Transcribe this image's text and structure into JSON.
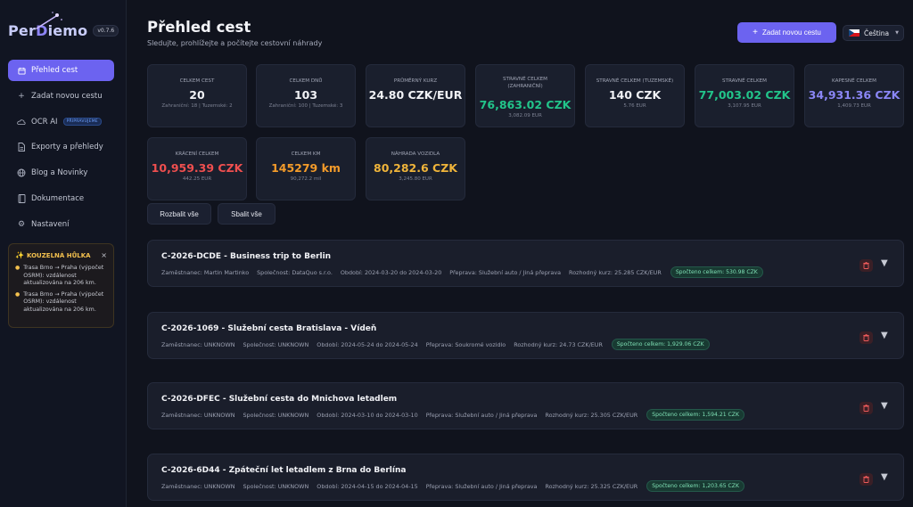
{
  "app": {
    "name_pre": "Per",
    "name_mid": "D",
    "name_post": "iemo",
    "version": "v0.7.6"
  },
  "sidebar": {
    "items": [
      {
        "label": "Přehled cest",
        "icon": "calendar-icon",
        "active": true
      },
      {
        "label": "Zadat novou cestu",
        "icon": "plus-icon"
      },
      {
        "label": "OCR AI",
        "icon": "cloud-icon",
        "badge": "PŘIPRAVUJEME"
      },
      {
        "label": "Exporty a přehledy",
        "icon": "document-icon"
      },
      {
        "label": "Blog a Novinky",
        "icon": "globe-icon"
      },
      {
        "label": "Dokumentace",
        "icon": "book-icon"
      },
      {
        "label": "Nastavení",
        "icon": "gear-icon"
      }
    ],
    "magic": {
      "title": "KOUZELNÁ HŮLKA",
      "close": "×",
      "items": [
        "Trasa Brno → Praha (výpočet OSRM): vzdálenost aktualizována na 206 km.",
        "Trasa Brno → Praha (výpočet OSRM): vzdálenost aktualizována na 206 km."
      ]
    }
  },
  "header": {
    "title": "Přehled cest",
    "subtitle": "Sledujte, prohlížejte a počítejte cestovní náhrady",
    "add_button": "Zadat novou cestu",
    "language": "Čeština"
  },
  "stats": [
    {
      "label": "CELKEM CEST",
      "value": "20",
      "sub": "Zahraniční: 18 | Tuzemské: 2",
      "color": "default"
    },
    {
      "label": "CELKEM DNŮ",
      "value": "103",
      "sub": "Zahraniční: 100 | Tuzemské: 3",
      "color": "default"
    },
    {
      "label": "PRŮMĚRNÝ KURZ",
      "value": "24.80 CZK/EUR",
      "sub": "",
      "color": "default"
    },
    {
      "label": "STRAVNÉ CELKEM",
      "label2": "(ZAHRANIČNÍ)",
      "value": "76,863.02 CZK",
      "sub": "3,082.09 EUR",
      "color": "green"
    },
    {
      "label": "STRAVNÉ CELKEM (TUZEMSKÉ)",
      "value": "140 CZK",
      "sub": "5.76 EUR",
      "color": "default"
    },
    {
      "label": "STRAVNÉ CELKEM",
      "value": "77,003.02 CZK",
      "sub": "3,107.95 EUR",
      "color": "green"
    },
    {
      "label": "KAPESNÉ CELKEM",
      "value": "34,931.36 CZK",
      "sub": "1,409.73 EUR",
      "color": "purple"
    },
    {
      "label": "KRÁCENÍ CELKEM",
      "value": "10,959.39 CZK",
      "sub": "442.25 EUR",
      "color": "red"
    },
    {
      "label": "CELKEM KM",
      "value": "145279 km",
      "sub": "90,272.2 mil",
      "color": "orange"
    },
    {
      "label": "NÁHRADA VOZIDLA",
      "value": "80,282.6 CZK",
      "sub": "3,245.80 EUR",
      "color": "yellow"
    }
  ],
  "actions": {
    "expand_all": "Rozbalit vše",
    "collapse_all": "Sbalit vše"
  },
  "trips": [
    {
      "title": "C-2026-DCDE - Business trip to Berlin",
      "employee": "Zaměstnanec: Martin Martinko",
      "company": "Společnost: DataQuo s.r.o.",
      "period": "Období: 2024-03-20 do 2024-03-20",
      "transport": "Přeprava: Služební auto / Jiná přeprava",
      "rate": "Rozhodný kurz: 25.285 CZK/EUR",
      "total": "Spočteno celkem: 530.98 CZK"
    },
    {
      "title": "C-2026-1069 - Služební cesta Bratislava - Vídeň",
      "employee": "Zaměstnanec: UNKNOWN",
      "company": "Společnost: UNKNOWN",
      "period": "Období: 2024-05-24 do 2024-05-24",
      "transport": "Přeprava: Soukromé vozidlo",
      "rate": "Rozhodný kurz: 24.73 CZK/EUR",
      "total": "Spočteno celkem: 1,929.06 CZK"
    },
    {
      "title": "C-2026-DFEC - Služební cesta do Mnichova letadlem",
      "employee": "Zaměstnanec: UNKNOWN",
      "company": "Společnost: UNKNOWN",
      "period": "Období: 2024-03-10 do 2024-03-10",
      "transport": "Přeprava: Služební auto / Jiná přeprava",
      "rate": "Rozhodný kurz: 25.305 CZK/EUR",
      "total": "Spočteno celkem: 1,594.21 CZK"
    },
    {
      "title": "C-2026-6D44 - Zpáteční let letadlem z Brna do Berlína",
      "employee": "Zaměstnanec: UNKNOWN",
      "company": "Společnost: UNKNOWN",
      "period": "Období: 2024-04-15 do 2024-04-15",
      "transport": "Přeprava: Služební auto / Jiná přeprava",
      "rate": "Rozhodný kurz: 25.325 CZK/EUR",
      "total": "Spočteno celkem: 1,203.65 CZK"
    }
  ],
  "icons": {
    "expand": "▼",
    "trash": "trash-icon"
  },
  "colors": {
    "accent": "#6c63f0",
    "green": "#22c48a",
    "purple": "#8a86f5",
    "red": "#ef4f4f",
    "orange": "#f39b2a",
    "yellow": "#efb43a"
  }
}
